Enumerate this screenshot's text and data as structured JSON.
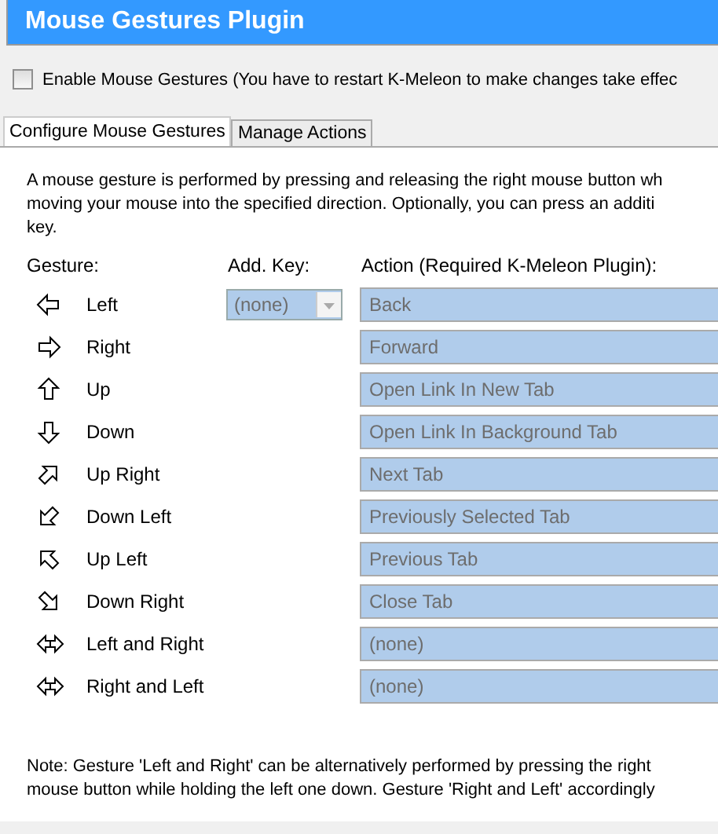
{
  "window": {
    "title": "Mouse Gestures Plugin"
  },
  "enable": {
    "label": "Enable Mouse Gestures (You have to restart K-Meleon to make changes take effec",
    "checked": false
  },
  "tabs": [
    {
      "label": "Configure Mouse Gestures",
      "selected": true
    },
    {
      "label": "Manage Actions",
      "selected": false
    }
  ],
  "intro": [
    "A mouse gesture is performed by pressing and releasing the right mouse button wh",
    "moving your mouse into the specified direction. Optionally, you can press an additi",
    "key."
  ],
  "columns": {
    "gesture": "Gesture:",
    "key": "Add. Key:",
    "action": "Action (Required K-Meleon Plugin):"
  },
  "gestures": [
    {
      "kind": "left",
      "label": "Left",
      "key": "(none)",
      "action": "Back"
    },
    {
      "kind": "right",
      "label": "Right",
      "action": "Forward"
    },
    {
      "kind": "up",
      "label": "Up",
      "action": "Open Link In New Tab"
    },
    {
      "kind": "down",
      "label": "Down",
      "action": "Open Link In Background Tab"
    },
    {
      "kind": "upright",
      "label": "Up Right",
      "action": "Next Tab"
    },
    {
      "kind": "downleft",
      "label": "Down Left",
      "action": "Previously Selected Tab"
    },
    {
      "kind": "upleft",
      "label": "Up Left",
      "action": "Previous Tab"
    },
    {
      "kind": "downright",
      "label": "Down Right",
      "action": "Close Tab"
    },
    {
      "kind": "leftright",
      "label": "Left and Right",
      "action": "(none)"
    },
    {
      "kind": "rightleft",
      "label": "Right and Left",
      "action": "(none)"
    }
  ],
  "note": [
    "Note: Gesture 'Left and Right' can be alternatively performed by pressing the right",
    "mouse button while holding the left one down. Gesture 'Right and Left' accordingly"
  ]
}
